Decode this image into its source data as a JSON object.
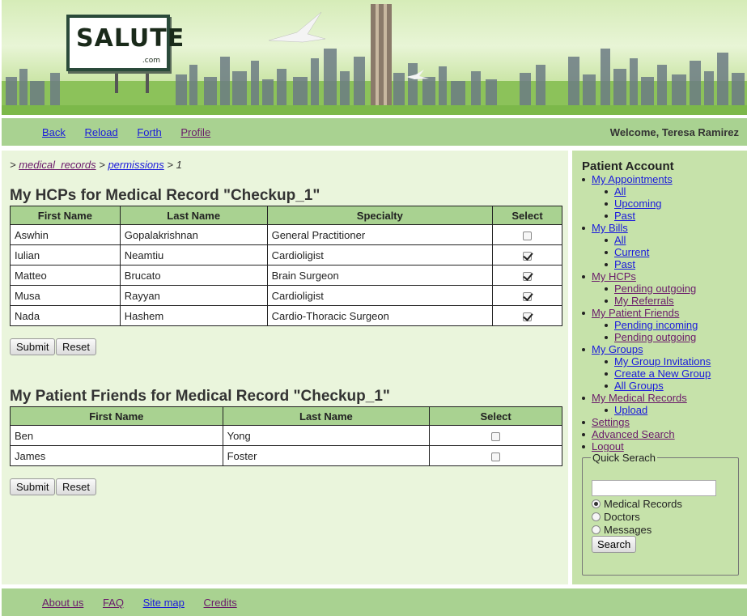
{
  "logo": {
    "text": "SALUTE",
    "sub": ".com"
  },
  "nav": {
    "back": "Back",
    "reload": "Reload",
    "forth": "Forth",
    "profile": "Profile",
    "welcome": "Welcome, Teresa Ramirez"
  },
  "breadcrumb": {
    "prefix": ">",
    "medical_records": "medical_records",
    "sep": ">",
    "permissions": "permissions",
    "tail": "> 1"
  },
  "hcps": {
    "title": "My HCPs for Medical Record \"Checkup_1\"",
    "headers": [
      "First Name",
      "Last Name",
      "Specialty",
      "Select"
    ],
    "rows": [
      {
        "first": "Aswhin",
        "last": "Gopalakrishnan",
        "specialty": "General Practitioner",
        "selected": false
      },
      {
        "first": "Iulian",
        "last": "Neamtiu",
        "specialty": "Cardioligist",
        "selected": true
      },
      {
        "first": "Matteo",
        "last": "Brucato",
        "specialty": "Brain Surgeon",
        "selected": true
      },
      {
        "first": "Musa",
        "last": "Rayyan",
        "specialty": "Cardioligist",
        "selected": true
      },
      {
        "first": "Nada",
        "last": "Hashem",
        "specialty": "Cardio-Thoracic Surgeon",
        "selected": true
      }
    ],
    "submit": "Submit",
    "reset": "Reset"
  },
  "friends": {
    "title": "My Patient Friends for Medical Record \"Checkup_1\"",
    "headers": [
      "First Name",
      "Last Name",
      "Select"
    ],
    "rows": [
      {
        "first": "Ben",
        "last": "Yong",
        "selected": false
      },
      {
        "first": "James",
        "last": "Foster",
        "selected": false
      }
    ],
    "submit": "Submit",
    "reset": "Reset"
  },
  "sidebar": {
    "title": "Patient Account",
    "menu": [
      {
        "label": "My Appointments",
        "level": 1
      },
      {
        "label": "All",
        "level": 2
      },
      {
        "label": "Upcoming",
        "level": 2
      },
      {
        "label": "Past",
        "level": 2
      },
      {
        "label": "My Bills",
        "level": 1
      },
      {
        "label": "All",
        "level": 2
      },
      {
        "label": "Current",
        "level": 2
      },
      {
        "label": "Past",
        "level": 2
      },
      {
        "label": "My HCPs",
        "level": 1,
        "visited": true
      },
      {
        "label": "Pending outgoing",
        "level": 2,
        "visited": true
      },
      {
        "label": "My Referrals",
        "level": 2,
        "visited": true
      },
      {
        "label": "My Patient Friends",
        "level": 1,
        "visited": true
      },
      {
        "label": "Pending incoming",
        "level": 2
      },
      {
        "label": "Pending outgoing",
        "level": 2,
        "visited": true
      },
      {
        "label": "My Groups",
        "level": 1
      },
      {
        "label": "My Group Invitations",
        "level": 2
      },
      {
        "label": "Create a New Group",
        "level": 2
      },
      {
        "label": "All Groups",
        "level": 2
      },
      {
        "label": "My Medical Records",
        "level": 1,
        "visited": true
      },
      {
        "label": "Upload",
        "level": 2
      },
      {
        "label": "Settings",
        "level": 1,
        "visited": true
      },
      {
        "label": "Advanced Search",
        "level": 1,
        "visited": true
      },
      {
        "label": "Logout",
        "level": 1,
        "visited": true
      }
    ],
    "quick_search": {
      "legend": "Quick Serach",
      "input_value": "",
      "options": [
        {
          "label": "Medical Records",
          "checked": true
        },
        {
          "label": "Doctors",
          "checked": false
        },
        {
          "label": "Messages",
          "checked": false
        }
      ],
      "button": "Search"
    }
  },
  "footer": {
    "about": "About us",
    "faq": "FAQ",
    "sitemap": "Site map",
    "credits": "Credits"
  },
  "colors": {
    "bar": "#a9d291",
    "main_bg": "#eaf5dc",
    "sidebar_bg": "#c6e2aa",
    "link": "#1a1adc",
    "visited": "#6a1a6a"
  }
}
